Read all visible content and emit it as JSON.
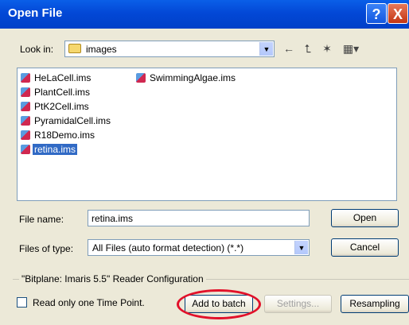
{
  "window": {
    "title": "Open File",
    "help_glyph": "?",
    "close_glyph": "X"
  },
  "lookin": {
    "label": "Look in:",
    "value": "images"
  },
  "toolbar_icons": [
    "back-arrow-icon",
    "up-folder-icon",
    "new-folder-icon",
    "view-menu-icon"
  ],
  "files_col1": [
    "HeLaCell.ims",
    "PlantCell.ims",
    "PtK2Cell.ims",
    "PyramidalCell.ims",
    "R18Demo.ims",
    "retina.ims"
  ],
  "files_col2": [
    "SwimmingAlgae.ims"
  ],
  "selected_file": "retina.ims",
  "filename": {
    "label": "File name:",
    "value": "retina.ims"
  },
  "filetype": {
    "label": "Files of type:",
    "value": "All Files (auto format detection) (*.*)"
  },
  "buttons": {
    "open": "Open",
    "cancel": "Cancel",
    "add_to_batch": "Add to batch",
    "settings": "Settings...",
    "resampling": "Resampling"
  },
  "reader_config": {
    "label": "\"Bitplane: Imaris 5.5\" Reader Configuration"
  },
  "checkbox": {
    "label": "Read only one Time Point.",
    "checked": false
  },
  "colors": {
    "titlebar": "#0348d6",
    "selection": "#316ac5",
    "highlight_oval": "#e2112a"
  }
}
